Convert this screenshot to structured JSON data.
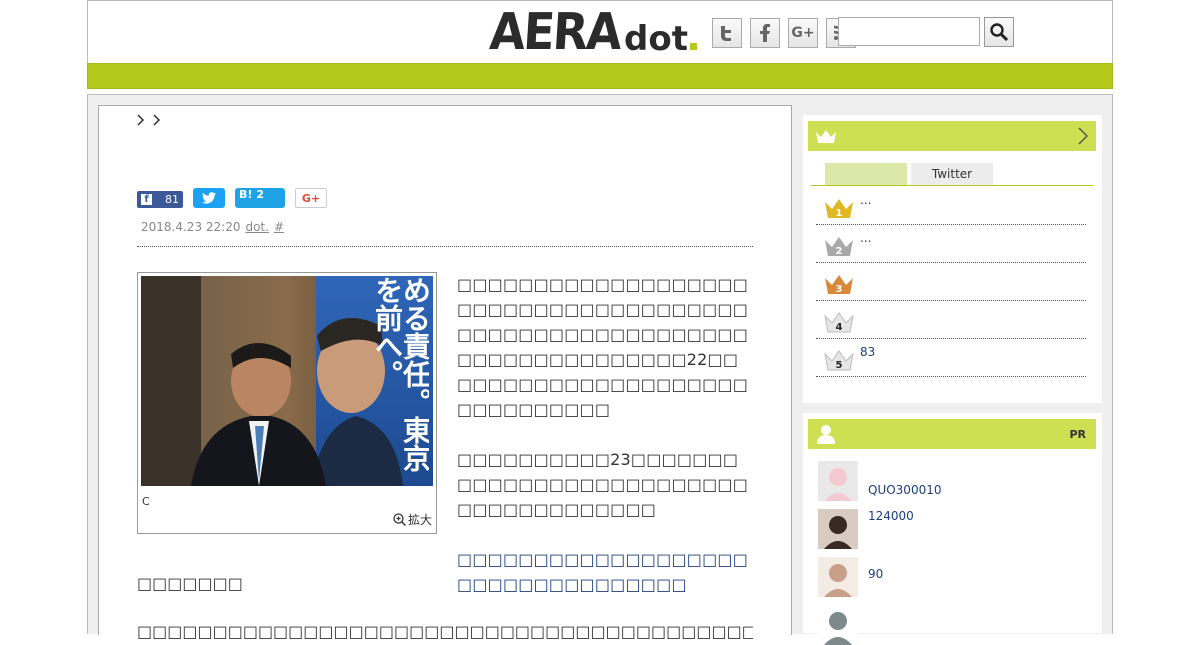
{
  "header": {
    "logo_main": "AERA",
    "logo_sub": "dot",
    "social": [
      "twitter-icon",
      "facebook-icon",
      "google-plus-icon",
      "rss-icon"
    ],
    "search_placeholder": ""
  },
  "colors": {
    "accent": "#b5c91c",
    "accent_light": "#cde052",
    "link": "#1d3f7c"
  },
  "article": {
    "breadcrumb": [
      ">",
      ">"
    ],
    "share": {
      "facebook_count": "81",
      "hatena_label": "B!",
      "hatena_count": "2",
      "gplus_label": "G+"
    },
    "date": "2018.4.23 22:20",
    "author": "dot.",
    "hash": "#",
    "photo_caption": "C",
    "zoom_label": "拡大",
    "poster_text": "める責任。東京を前へ。",
    "paragraph1": "□□□□□□□□□□□□□□□□□□□□□□□□□□□□□□□□□□□□□□□□□□□□□□□□□□□□□□□□□□□□□□□□□□□□□□□□22□□□□□□□□□□□□□□□□□□□□□□□□□□□□□□□",
    "paragraph2": "□□□□□□□□□□23□□□□□□□□□□□□□□□□□□□□□□□□□□□□□□□□□□□□□□□",
    "link_paragraph": "□□□□□□□□□□□□□□□□□□□□□□□□□□□□□□□□□□",
    "subhead": "□□□□□□□",
    "last_line": "□□□□□□□□□□□□□□□□□□□□□□□□□□□□□□□□□□□□□□□□□□□□□□□□□□□□"
  },
  "ranking": {
    "tabs": [
      "",
      "Twitter"
    ],
    "items": [
      {
        "rank": "1",
        "text": "...",
        "color": "#e0b824"
      },
      {
        "rank": "2",
        "text": "...",
        "color": "#a9a9a9"
      },
      {
        "rank": "3",
        "text": "",
        "color": "#d9893a"
      },
      {
        "rank": "4",
        "text": "",
        "color": "#e6e6e6"
      },
      {
        "rank": "5",
        "text": "83",
        "color": "#e6e6e6"
      }
    ]
  },
  "pr": {
    "label": "PR",
    "items": [
      {
        "text": "QUO300010"
      },
      {
        "text": "124000"
      },
      {
        "text": "90"
      },
      {
        "text": ""
      }
    ]
  }
}
